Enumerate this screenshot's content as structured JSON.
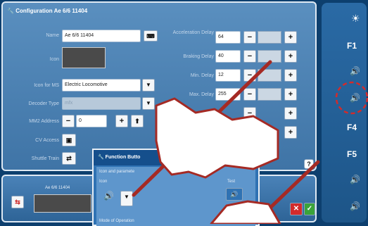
{
  "main": {
    "title": "Configuration Ae 6/6 11404",
    "name_label": "Name",
    "name_value": "Ae 6/6 11404",
    "icon_label": "Icon",
    "icon_ms_label": "Icon for MS",
    "icon_ms_value": "Electric Locomotive",
    "decoder_label": "Decoder Type",
    "decoder_value": "mfx",
    "mm2_label": "MM2 Address",
    "mm2_value": "0",
    "cv_label": "CV Access",
    "shuttle_label": "Shuttle Train",
    "accel_label": "Acceleration Delay",
    "accel_value": "64",
    "braking_label": "Braking Delay",
    "braking_value": "40",
    "min_label": "Min. Delay",
    "min_value": "12",
    "max_label": "Max. Delay",
    "max_value": "255",
    "minus": "−",
    "plus": "+",
    "help": "?"
  },
  "right_panel": {
    "keys": [
      "F1",
      "F4",
      "F5"
    ]
  },
  "bottom": {
    "loco_name": "Ae 6/6 11404"
  },
  "function_dialog": {
    "title": "Function Butto",
    "icon_and_params": "Icon and paramete",
    "icon_label": "Icon",
    "test_label": "Test",
    "mode_label": "Mode of Operation"
  },
  "colors": {
    "accent": "#2f72b3",
    "pen": "#a52a24",
    "ok": "#3aa33a",
    "cancel": "#d32b2b"
  }
}
